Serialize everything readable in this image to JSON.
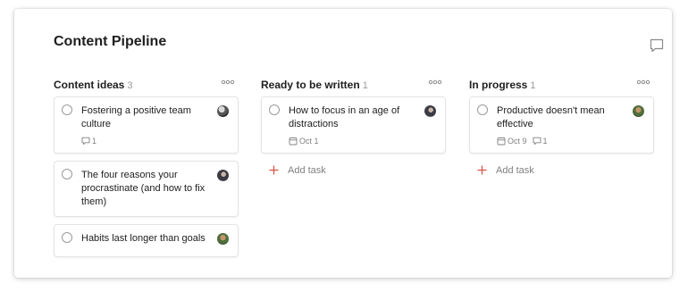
{
  "board": {
    "title": "Content Pipeline"
  },
  "columns": [
    {
      "title": "Content ideas",
      "count": "3",
      "cards": [
        {
          "text": "Fostering a positive team culture",
          "comments": "1"
        },
        {
          "text": "The four reasons your procrastinate (and how to fix them)"
        },
        {
          "text": "Habits last longer than goals"
        }
      ]
    },
    {
      "title": "Ready to be written",
      "count": "1",
      "cards": [
        {
          "text": "How to focus in an age of distractions",
          "date": "Oct 1"
        }
      ],
      "add_task": "Add task"
    },
    {
      "title": "In progress",
      "count": "1",
      "cards": [
        {
          "text": "Productive doesn't mean effective",
          "date": "Oct 9",
          "comments": "1"
        }
      ],
      "add_task": "Add task"
    }
  ],
  "colors": {
    "add_plus": "#db4c3f"
  },
  "icons": [
    "comment-icon",
    "more-icon",
    "calendar-icon",
    "plus-icon"
  ]
}
